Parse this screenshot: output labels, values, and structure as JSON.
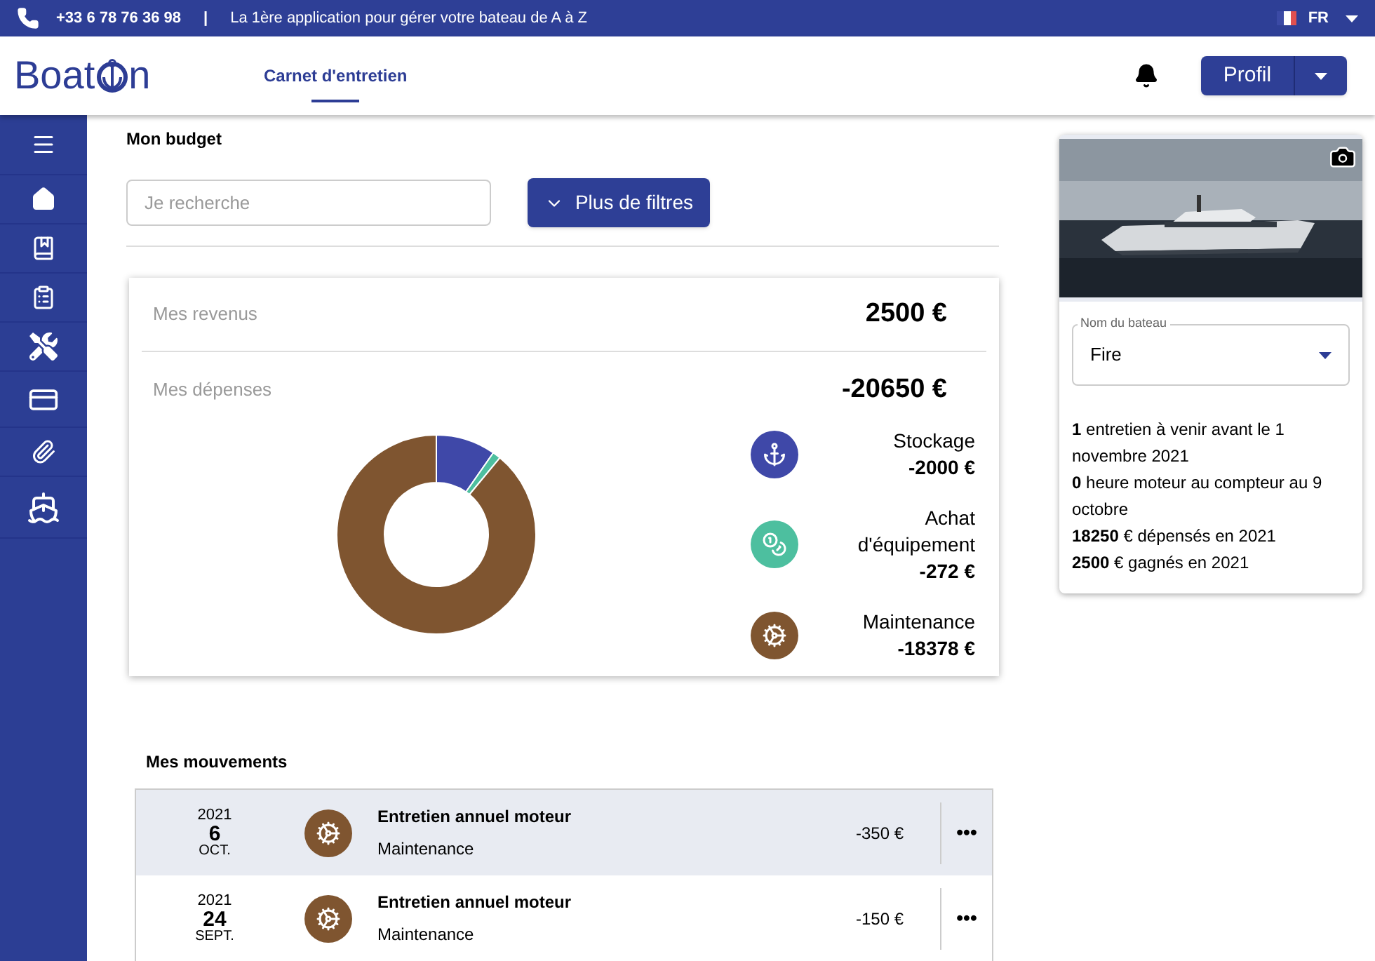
{
  "top_bar": {
    "phone": "+33 6 78 76 36 98",
    "separator": "|",
    "tagline": "La 1ère application pour gérer votre bateau de A à Z",
    "language": "FR"
  },
  "header": {
    "logo_start": "Boat",
    "logo_end": "n",
    "nav": [
      {
        "label": "Carnet d'entretien",
        "selected": true
      }
    ],
    "profile_button": "Profil"
  },
  "budget": {
    "title": "Mon budget",
    "search": {
      "placeholder": "Je recherche"
    },
    "filters_button": "Plus de filtres",
    "income": {
      "label": "Mes revenus",
      "value": "2500 €"
    },
    "expenses": {
      "label": "Mes dépenses",
      "value": "-20650 €"
    },
    "categories": [
      {
        "kind": "anchor",
        "name": "Stockage",
        "amount": "-2000 €",
        "color": "#3f48a8"
      },
      {
        "kind": "coins",
        "name": "Achat d'équipement",
        "amount": "-272 €",
        "color": "#4dbf9f"
      },
      {
        "kind": "gears",
        "name": "Maintenance",
        "amount": "-18378 €",
        "color": "#7f5530"
      }
    ]
  },
  "movements": {
    "title": "Mes mouvements",
    "rows": [
      {
        "selected": true,
        "year": "2021",
        "day": "6",
        "month": "OCT.",
        "title": "Entretien annuel moteur",
        "category": "Maintenance",
        "amount": "-350 €",
        "menu": "•••"
      },
      {
        "selected": false,
        "year": "2021",
        "day": "24",
        "month": "SEPT.",
        "title": "Entretien annuel moteur",
        "category": "Maintenance",
        "amount": "-150 €",
        "menu": "•••"
      }
    ]
  },
  "boat_card": {
    "name_field": {
      "label": "Nom du bateau",
      "value": "Fire"
    },
    "summary": [
      "**1** entretien à venir avant le 1 novembre 2021",
      "**0** heure moteur au compteur au 9 octobre",
      "**18250** € dépensés en 2021",
      "**2500** € gagnés en 2021"
    ]
  }
}
